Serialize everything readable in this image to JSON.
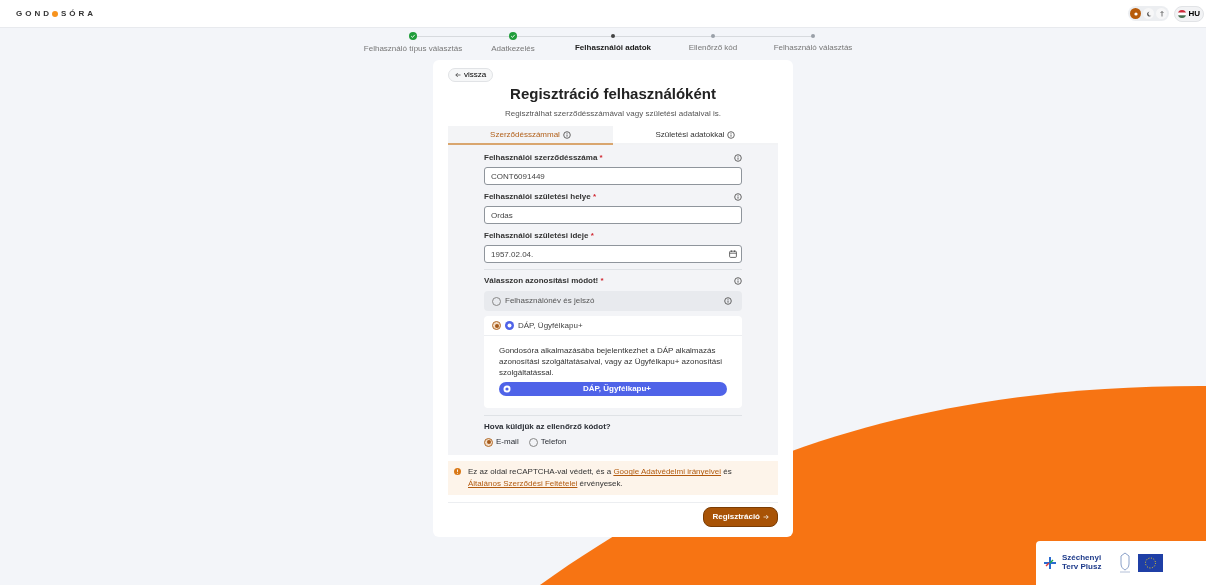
{
  "header": {
    "logo": [
      "GOND",
      "SÓRA"
    ],
    "theme_buttons": [
      {
        "kind": "light",
        "selected": true
      },
      {
        "kind": "dark",
        "selected": false
      },
      {
        "kind": "contrast",
        "selected": false
      }
    ],
    "language": "HU"
  },
  "stepper": [
    {
      "label": "Felhasználó típus választás",
      "completed": true,
      "selected": false
    },
    {
      "label": "Adatkezelés",
      "completed": true,
      "selected": false
    },
    {
      "label": "Felhasználói adatok",
      "completed": false,
      "selected": true
    },
    {
      "label": "Ellenőrző kód",
      "completed": false,
      "selected": false
    },
    {
      "label": "Felhasználó választás",
      "completed": false,
      "selected": false
    }
  ],
  "card": {
    "back": "vissza",
    "title": "Regisztráció felhasználóként",
    "subtitle": "Regisztrálhat szerződésszámával vagy születési adataival is.",
    "tabs": [
      {
        "label": "Szerződésszámmal",
        "selected": true
      },
      {
        "label": "Születési adatokkal",
        "selected": false
      }
    ],
    "fields": [
      {
        "label": "Felhasználói szerződésszáma",
        "required_mark": "*",
        "info": true,
        "kind": "text",
        "value": "CONT6091449"
      },
      {
        "label": "Felhasználói születési helye",
        "required_mark": "*",
        "info": true,
        "kind": "text",
        "value": "Ordas"
      },
      {
        "label": "Felhasználói születési ideje",
        "required_mark": "*",
        "info": false,
        "kind": "date",
        "value": "1957.02.04."
      }
    ],
    "auth": {
      "label": "Válasszon azonosítási módot!",
      "required_mark": "*",
      "info": true,
      "options": [
        {
          "kind": "password",
          "label": "Felhasználónév és jelszó",
          "selected": false,
          "expanded": false
        },
        {
          "kind": "dap",
          "label": "DÁP, Ügyfélkapu+",
          "selected": true,
          "expanded": true,
          "description": "Gondosóra alkalmazásába bejelentkezhet a DÁP alkalmazás azonosítási szolgáltatásaival, vagy az Ügyfélkapu+ azonosítási szolgáltatással.",
          "button": "DÁP, Ügyfélkapu+"
        }
      ]
    },
    "delivery": {
      "label": "Hova küldjük az ellenőrző kódot?",
      "options": [
        {
          "label": "E-mail",
          "selected": true
        },
        {
          "label": "Telefon",
          "selected": false
        }
      ]
    },
    "notice": [
      {
        "kind": "text",
        "text": "Ez az oldal reCAPTCHA-val védett, és a "
      },
      {
        "kind": "link",
        "text": "Google Adatvédelmi irányelvei"
      },
      {
        "kind": "text",
        "text": " és "
      },
      {
        "kind": "link",
        "text": "Általános Szerződési Feltételei"
      },
      {
        "kind": "text",
        "text": " érvényesek."
      }
    ],
    "submit": "Regisztráció"
  },
  "footer_logos": {
    "title": "Széchenyi Terv Plusz"
  }
}
